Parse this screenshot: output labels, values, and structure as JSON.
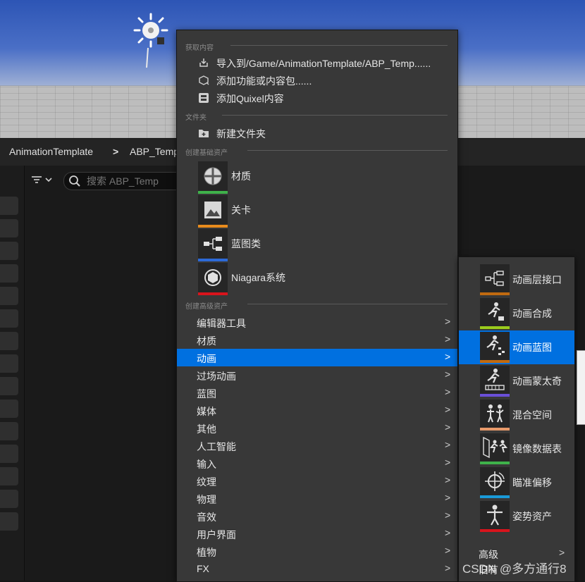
{
  "breadcrumb": {
    "items": [
      "AnimationTemplate",
      "ABP_Temp"
    ],
    "separator": ">"
  },
  "search": {
    "placeholder": "搜索 ABP_Temp"
  },
  "menu": {
    "sections": {
      "get_content": "获取内容",
      "folder": "文件夹",
      "basic_assets": "创建基础资产",
      "advanced_assets": "创建高级资产"
    },
    "get_content_items": [
      {
        "label": "导入到/Game/AnimationTemplate/ABP_Temp......",
        "icon": "import-icon"
      },
      {
        "label": "添加功能或内容包......",
        "icon": "feature-pack-icon"
      },
      {
        "label": "添加Quixel内容",
        "icon": "quixel-icon"
      }
    ],
    "folder_items": [
      {
        "label": "新建文件夹",
        "icon": "new-folder-icon"
      }
    ],
    "basic_assets": [
      {
        "label": "材质",
        "icon": "material-icon",
        "color": "#3fb24a"
      },
      {
        "label": "关卡",
        "icon": "level-icon",
        "color": "#e88b1c"
      },
      {
        "label": "蓝图类",
        "icon": "blueprint-icon",
        "color": "#2d6ad8"
      },
      {
        "label": "Niagara系统",
        "icon": "niagara-icon",
        "color": "#d8141c"
      }
    ],
    "advanced_assets": [
      {
        "label": "编辑器工具",
        "active": false
      },
      {
        "label": "材质",
        "active": false
      },
      {
        "label": "动画",
        "active": true
      },
      {
        "label": "过场动画",
        "active": false
      },
      {
        "label": "蓝图",
        "active": false
      },
      {
        "label": "媒体",
        "active": false
      },
      {
        "label": "其他",
        "active": false
      },
      {
        "label": "人工智能",
        "active": false
      },
      {
        "label": "输入",
        "active": false
      },
      {
        "label": "纹理",
        "active": false
      },
      {
        "label": "物理",
        "active": false
      },
      {
        "label": "音效",
        "active": false
      },
      {
        "label": "用户界面",
        "active": false
      },
      {
        "label": "植物",
        "active": false
      },
      {
        "label": "FX",
        "active": false
      }
    ],
    "chevron": ">"
  },
  "submenu": {
    "items": [
      {
        "label": "动画层接口",
        "icon": "anim-layer-interface-icon",
        "color": "#c06a10",
        "active": false
      },
      {
        "label": "动画合成",
        "icon": "anim-composite-icon",
        "color": "#9acb1c",
        "active": false
      },
      {
        "label": "动画蓝图",
        "icon": "anim-blueprint-icon",
        "color": "#c06a10",
        "active": true
      },
      {
        "label": "动画蒙太奇",
        "icon": "anim-montage-icon",
        "color": "#6a4fd8",
        "active": false
      },
      {
        "label": "混合空间",
        "icon": "blend-space-icon",
        "color": "#e89a6a",
        "active": false
      },
      {
        "label": "镜像数据表",
        "icon": "mirror-table-icon",
        "color": "#3fb24a",
        "active": false
      },
      {
        "label": "瞄准偏移",
        "icon": "aim-offset-icon",
        "color": "#1a9ad8",
        "active": false
      },
      {
        "label": "姿势资产",
        "icon": "pose-asset-icon",
        "color": "#d8141c",
        "active": false
      }
    ],
    "advanced": "高级",
    "cut_off": "旧有"
  },
  "watermark": "CSDN @多方通行8",
  "colors": {
    "menu_bg": "#383838",
    "highlight": "#0070e0",
    "text": "#e6e6e6"
  }
}
